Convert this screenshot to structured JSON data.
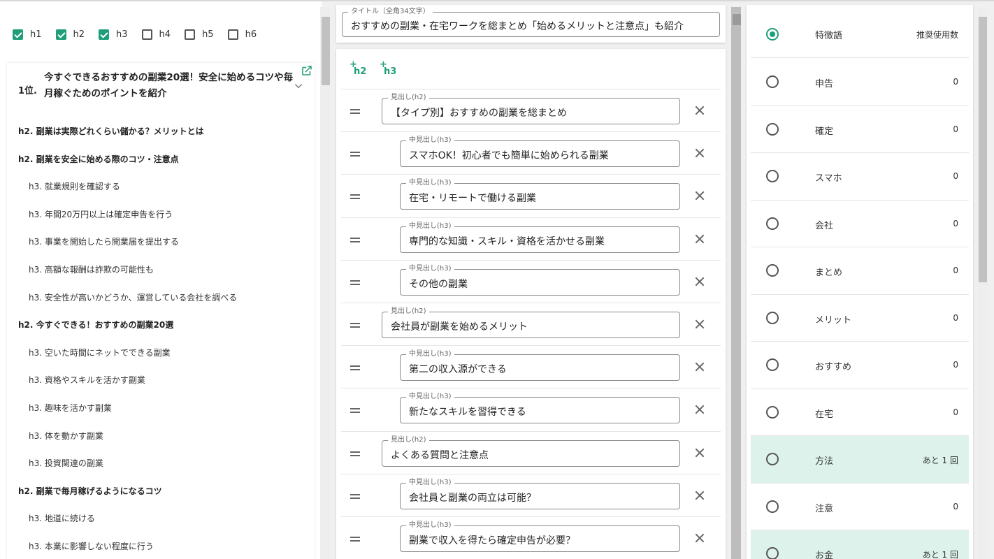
{
  "filters": [
    {
      "label": "h1",
      "checked": true
    },
    {
      "label": "h2",
      "checked": true
    },
    {
      "label": "h3",
      "checked": true
    },
    {
      "label": "h4",
      "checked": false
    },
    {
      "label": "h5",
      "checked": false
    },
    {
      "label": "h6",
      "checked": false
    }
  ],
  "competitor": {
    "rank_label": "1位.",
    "title": "今すぐできるおすすめの副業20選！安全に始めるコツや毎月稼ぐためのポイントを紹介",
    "outline": [
      {
        "level": "h2",
        "text": "h2. 副業は実際どれくらい儲かる？メリットとは"
      },
      {
        "level": "h2",
        "text": "h2. 副業を安全に始める際のコツ・注意点"
      },
      {
        "level": "h3",
        "text": "h3. 就業規則を確認する"
      },
      {
        "level": "h3",
        "text": "h3. 年間20万円以上は確定申告を行う"
      },
      {
        "level": "h3",
        "text": "h3. 事業を開始したら開業届を提出する"
      },
      {
        "level": "h3",
        "text": "h3. 高額な報酬は詐欺の可能性も"
      },
      {
        "level": "h3",
        "text": "h3. 安全性が高いかどうか、運営している会社を調べる"
      },
      {
        "level": "h2",
        "text": "h2. 今すぐできる！おすすめの副業20選"
      },
      {
        "level": "h3",
        "text": "h3. 空いた時間にネットでできる副業"
      },
      {
        "level": "h3",
        "text": "h3. 資格やスキルを活かす副業"
      },
      {
        "level": "h3",
        "text": "h3. 趣味を活かす副業"
      },
      {
        "level": "h3",
        "text": "h3. 体を動かす副業"
      },
      {
        "level": "h3",
        "text": "h3. 投資関連の副業"
      },
      {
        "level": "h2",
        "text": "h2. 副業で毎月稼げるようになるコツ"
      },
      {
        "level": "h3",
        "text": "h3. 地道に続ける"
      },
      {
        "level": "h3",
        "text": "h3. 本業に影響しない程度に行う"
      }
    ]
  },
  "editor": {
    "title_legend": "タイトル（全角34文字）",
    "title_value": "おすすめの副業・在宅ワークを総まとめ「始めるメリットと注意点」も紹介",
    "add_buttons": [
      {
        "plus": "+",
        "label": "h2"
      },
      {
        "plus": "+",
        "label": "h3"
      }
    ],
    "headings": [
      {
        "level": "h2",
        "legend": "見出し(h2)",
        "value": "【タイプ別】おすすめの副業を総まとめ"
      },
      {
        "level": "h3",
        "legend": "中見出し(h3)",
        "value": "スマホOK！初心者でも簡単に始められる副業"
      },
      {
        "level": "h3",
        "legend": "中見出し(h3)",
        "value": "在宅・リモートで働ける副業"
      },
      {
        "level": "h3",
        "legend": "中見出し(h3)",
        "value": "専門的な知識・スキル・資格を活かせる副業"
      },
      {
        "level": "h3",
        "legend": "中見出し(h3)",
        "value": "その他の副業"
      },
      {
        "level": "h2",
        "legend": "見出し(h2)",
        "value": "会社員が副業を始めるメリット"
      },
      {
        "level": "h3",
        "legend": "中見出し(h3)",
        "value": "第二の収入源ができる"
      },
      {
        "level": "h3",
        "legend": "中見出し(h3)",
        "value": "新たなスキルを習得できる"
      },
      {
        "level": "h2",
        "legend": "見出し(h2)",
        "value": "よくある質問と注意点"
      },
      {
        "level": "h3",
        "legend": "中見出し(h3)",
        "value": "会社員と副業の両立は可能？"
      },
      {
        "level": "h3",
        "legend": "中見出し(h3)",
        "value": "副業で収入を得たら確定申告が必要？"
      }
    ]
  },
  "keywords": {
    "header_name": "特徴語",
    "header_count": "推奨使用数",
    "highlight_color": "#dcf2ea",
    "accent_color": "#1f9e7a",
    "rows": [
      {
        "name": "申告",
        "count": "0",
        "highlight": false
      },
      {
        "name": "確定",
        "count": "0",
        "highlight": false
      },
      {
        "name": "スマホ",
        "count": "0",
        "highlight": false
      },
      {
        "name": "会社",
        "count": "0",
        "highlight": false
      },
      {
        "name": "まとめ",
        "count": "0",
        "highlight": false
      },
      {
        "name": "メリット",
        "count": "0",
        "highlight": false
      },
      {
        "name": "おすすめ",
        "count": "0",
        "highlight": false
      },
      {
        "name": "在宅",
        "count": "0",
        "highlight": false
      },
      {
        "name": "方法",
        "count": "あと 1 回",
        "highlight": true
      },
      {
        "name": "注意",
        "count": "0",
        "highlight": false
      },
      {
        "name": "お金",
        "count": "あと 1 回",
        "highlight": true
      }
    ]
  }
}
